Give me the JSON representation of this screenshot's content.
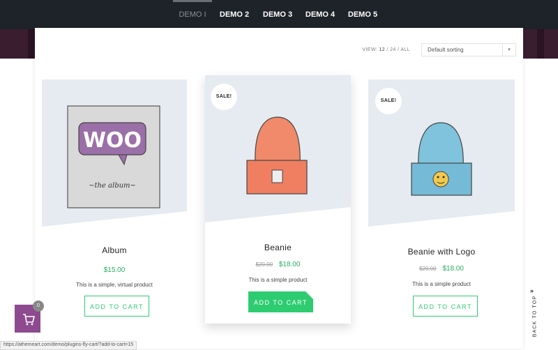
{
  "nav": {
    "tabs": [
      {
        "label": "DEMO I"
      },
      {
        "label": "DEMO 2"
      },
      {
        "label": "DEMO 3"
      },
      {
        "label": "DEMO 4"
      },
      {
        "label": "DEMO 5"
      }
    ]
  },
  "toolbar": {
    "view_label": "VIEW:",
    "view_options": [
      "12",
      "24",
      "ALL"
    ],
    "view_selected": "12",
    "sort_value": "Default sorting"
  },
  "products": [
    {
      "title": "Album",
      "price": "$15.00",
      "old_price": "",
      "description": "This is a simple, virtual product",
      "button": "ADD TO CART",
      "badge": "",
      "image_icon": "woo-album-icon",
      "art_text_1": "WOO",
      "art_text_2": "~the album~"
    },
    {
      "title": "Beanie",
      "price": "$18.00",
      "old_price": "$20.00",
      "description": "This is a simple product",
      "button": "ADD TO CART",
      "badge": "SALE!",
      "image_icon": "beanie-icon"
    },
    {
      "title": "Beanie with Logo",
      "price": "$18.00",
      "old_price": "$20.00",
      "description": "This is a simple product",
      "button": "ADD TO CART",
      "badge": "SALE!",
      "image_icon": "beanie-with-logo-icon"
    }
  ],
  "cart": {
    "count": "0",
    "icon": "cart-icon"
  },
  "status_url": "https://athemeart.com/demo/plugins-fly-cart/?add-to-cart=15",
  "back_to_top": "BACK TO TOP",
  "colors": {
    "accent": "#2ecc71",
    "nav_bg": "#1e2329",
    "cart_bg": "#8e4a8e",
    "band": "#3a1e30"
  }
}
